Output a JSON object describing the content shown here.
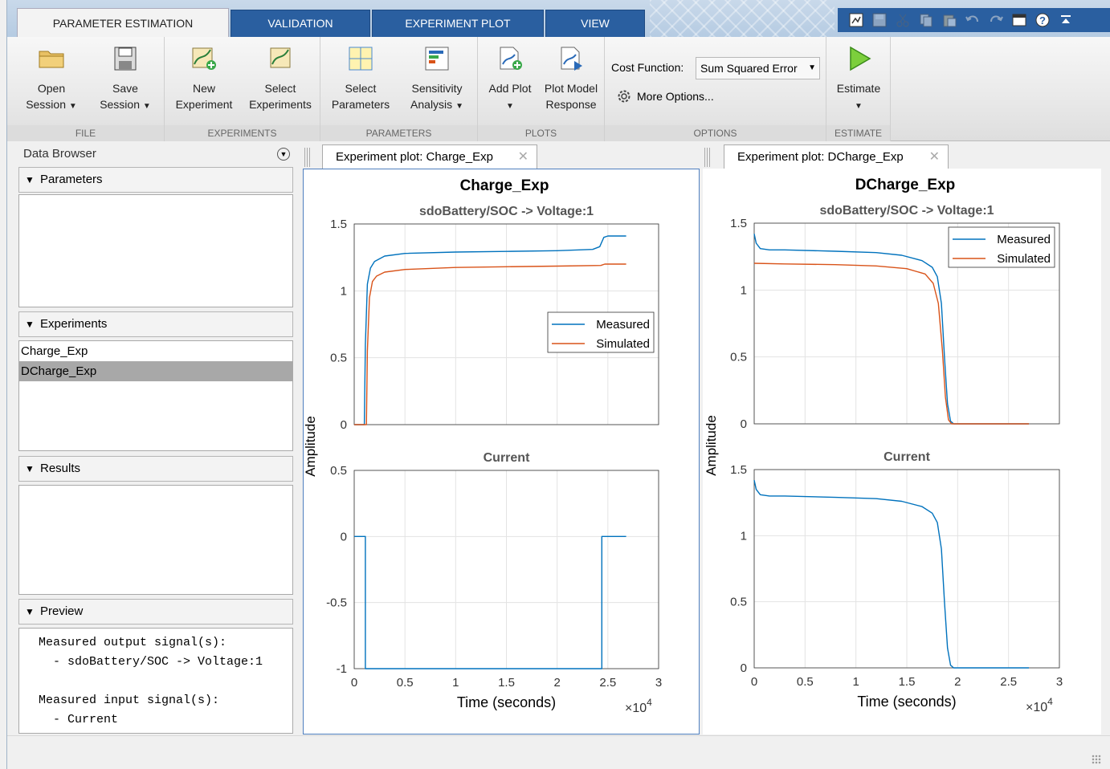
{
  "tabs": [
    {
      "label": "PARAMETER ESTIMATION",
      "active": true
    },
    {
      "label": "VALIDATION",
      "active": false
    },
    {
      "label": "EXPERIMENT PLOT",
      "active": false
    },
    {
      "label": "VIEW",
      "active": false
    }
  ],
  "quick_access": [
    "plot-tools-icon",
    "save-icon",
    "cut-icon",
    "copy-icon",
    "paste-icon",
    "undo-icon",
    "redo-icon",
    "window-icon",
    "help-icon",
    "collapse-ribbon-icon"
  ],
  "ribbon": {
    "file": {
      "label": "FILE",
      "open": "Open",
      "open2": "Session",
      "save": "Save",
      "save2": "Session"
    },
    "experiments": {
      "label": "EXPERIMENTS",
      "new": "New",
      "new2": "Experiment",
      "select": "Select",
      "select2": "Experiments"
    },
    "parameters": {
      "label": "PARAMETERS",
      "select": "Select",
      "select2": "Parameters",
      "sens": "Sensitivity",
      "sens2": "Analysis"
    },
    "plots": {
      "label": "PLOTS",
      "add": "Add Plot",
      "model": "Plot Model",
      "model2": "Response"
    },
    "options": {
      "label": "OPTIONS",
      "cost_label": "Cost Function:",
      "cost_value": "Sum Squared Error",
      "more": "More Options..."
    },
    "estimate": {
      "label": "ESTIMATE",
      "button": "Estimate"
    }
  },
  "browser": {
    "title": "Data Browser",
    "parameters_label": "Parameters",
    "experiments_label": "Experiments",
    "experiments": [
      "Charge_Exp",
      "DCharge_Exp"
    ],
    "selected_experiment": "DCharge_Exp",
    "results_label": "Results",
    "preview_label": "Preview",
    "preview_text": "Measured output signal(s):\n  - sdoBattery/SOC -> Voltage:1\n\nMeasured input signal(s):\n  - Current"
  },
  "docs": [
    {
      "tab": "Experiment plot: Charge_Exp"
    },
    {
      "tab": "Experiment plot: DCharge_Exp"
    }
  ],
  "colors": {
    "measured": "#0072bd",
    "simulated": "#d95319",
    "tab_blue": "#2a5fa0"
  },
  "chart_data": [
    {
      "type": "line",
      "title": "Charge_Exp",
      "panels": [
        {
          "subtitle": "sdoBattery/SOC -> Voltage:1",
          "ylim": [
            0,
            1.5
          ],
          "yticks": [
            "0",
            "0.5",
            "1",
            "1.5"
          ],
          "legend": [
            "Measured",
            "Simulated"
          ],
          "legend_position": "middle-right",
          "series": [
            {
              "name": "Measured",
              "x": [
                0,
                1000,
                1100,
                1300,
                1600,
                2000,
                3000,
                5000,
                10000,
                15000,
                20000,
                23500,
                24200,
                24600,
                25000,
                26800
              ],
              "y": [
                0,
                0,
                0.6,
                1.05,
                1.17,
                1.22,
                1.26,
                1.28,
                1.29,
                1.295,
                1.3,
                1.31,
                1.33,
                1.4,
                1.41,
                1.41
              ]
            },
            {
              "name": "Simulated",
              "x": [
                0,
                1200,
                1300,
                1500,
                1800,
                2200,
                3000,
                5000,
                10000,
                15000,
                20000,
                24300,
                24700,
                26800
              ],
              "y": [
                0,
                0,
                0.55,
                0.95,
                1.07,
                1.11,
                1.14,
                1.16,
                1.175,
                1.18,
                1.185,
                1.19,
                1.2,
                1.2
              ]
            }
          ]
        },
        {
          "subtitle": "Current",
          "ylim": [
            -1,
            0.5
          ],
          "yticks": [
            "-1",
            "-0.5",
            "0",
            "0.5"
          ],
          "series": [
            {
              "name": "Measured",
              "x": [
                0,
                1100,
                1100,
                24400,
                24400,
                26800
              ],
              "y": [
                0,
                0,
                -1,
                -1,
                0,
                0
              ]
            }
          ]
        }
      ],
      "xlim": [
        0,
        30000
      ],
      "xticks": [
        "0",
        "0.5",
        "1",
        "1.5",
        "2",
        "2.5",
        "3"
      ],
      "xlabel": "Time (seconds)",
      "ylabel": "Amplitude",
      "xexponent": "×10",
      "xexponent_power": "4"
    },
    {
      "type": "line",
      "title": "DCharge_Exp",
      "panels": [
        {
          "subtitle": "sdoBattery/SOC -> Voltage:1",
          "ylim": [
            0,
            1.5
          ],
          "yticks": [
            "0",
            "0.5",
            "1",
            "1.5"
          ],
          "legend": [
            "Measured",
            "Simulated"
          ],
          "legend_position": "top-right",
          "series": [
            {
              "name": "Measured",
              "x": [
                0,
                200,
                600,
                1500,
                3000,
                8000,
                12000,
                14500,
                16500,
                17500,
                18000,
                18400,
                18700,
                19000,
                19300,
                19600,
                27000
              ],
              "y": [
                1.42,
                1.35,
                1.31,
                1.3,
                1.3,
                1.29,
                1.28,
                1.26,
                1.22,
                1.17,
                1.1,
                0.9,
                0.5,
                0.15,
                0.02,
                0,
                0
              ]
            },
            {
              "name": "Simulated",
              "x": [
                0,
                3000,
                8000,
                12000,
                15000,
                16800,
                17600,
                18100,
                18500,
                18800,
                19100,
                19400,
                27000
              ],
              "y": [
                1.2,
                1.195,
                1.19,
                1.18,
                1.16,
                1.12,
                1.05,
                0.9,
                0.55,
                0.2,
                0.03,
                0,
                0
              ]
            }
          ]
        },
        {
          "subtitle": "Current",
          "ylim": [
            0,
            1.5
          ],
          "yticks": [
            "0",
            "0.5",
            "1",
            "1.5"
          ],
          "series": [
            {
              "name": "Measured",
              "x": [
                0,
                200,
                600,
                1500,
                3000,
                8000,
                12000,
                14500,
                16500,
                17500,
                18000,
                18400,
                18700,
                19000,
                19300,
                19600,
                27000
              ],
              "y": [
                1.42,
                1.35,
                1.31,
                1.3,
                1.3,
                1.29,
                1.28,
                1.26,
                1.22,
                1.17,
                1.1,
                0.9,
                0.5,
                0.15,
                0.02,
                0,
                0
              ]
            }
          ]
        }
      ],
      "xlim": [
        0,
        30000
      ],
      "xticks": [
        "0",
        "0.5",
        "1",
        "1.5",
        "2",
        "2.5",
        "3"
      ],
      "xlabel": "Time (seconds)",
      "ylabel": "Amplitude",
      "xexponent": "×10",
      "xexponent_power": "4"
    }
  ]
}
